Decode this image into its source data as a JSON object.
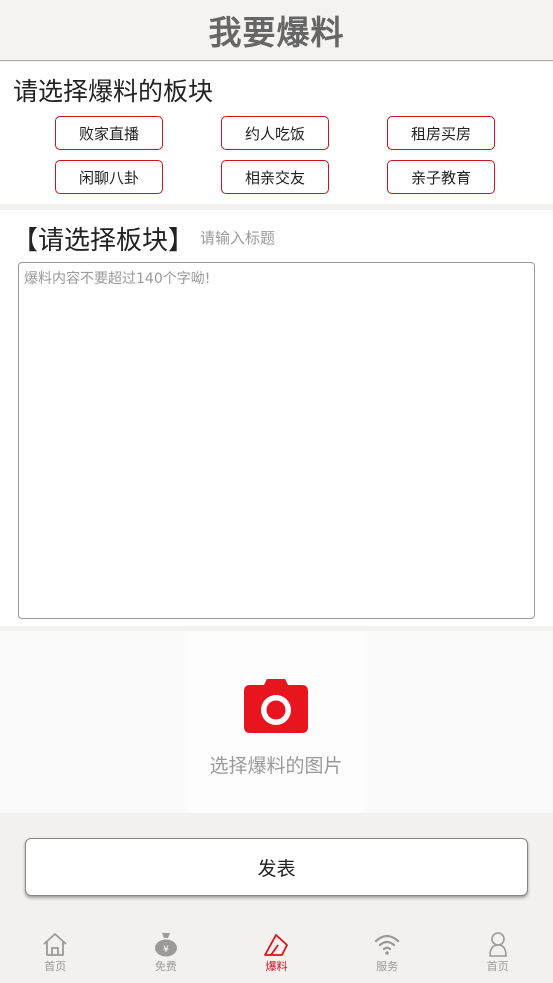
{
  "header": {
    "title": "我要爆料"
  },
  "categories": {
    "heading": "请选择爆料的板块",
    "items": [
      {
        "label": "败家直播"
      },
      {
        "label": "约人吃饭"
      },
      {
        "label": "租房买房"
      },
      {
        "label": "闲聊八卦"
      },
      {
        "label": "相亲交友"
      },
      {
        "label": "亲子教育"
      }
    ]
  },
  "compose": {
    "selected_category": "【请选择板块】",
    "title_placeholder": "请输入标题",
    "title_value": "",
    "content_placeholder": "爆料内容不要超过140个字呦!",
    "content_value": ""
  },
  "upload": {
    "label": "选择爆料的图片",
    "icon": "camera-icon"
  },
  "submit": {
    "label": "发表"
  },
  "tabbar": {
    "items": [
      {
        "label": "首页",
        "icon": "home-icon"
      },
      {
        "label": "免费",
        "icon": "money-bag-icon"
      },
      {
        "label": "爆料",
        "icon": "report-icon",
        "active": true
      },
      {
        "label": "服务",
        "icon": "wifi-icon"
      },
      {
        "label": "首页",
        "icon": "user-icon"
      }
    ]
  },
  "colors": {
    "accent": "#d9121c",
    "border_red": "#c9151e",
    "muted": "#9a9a9a"
  }
}
